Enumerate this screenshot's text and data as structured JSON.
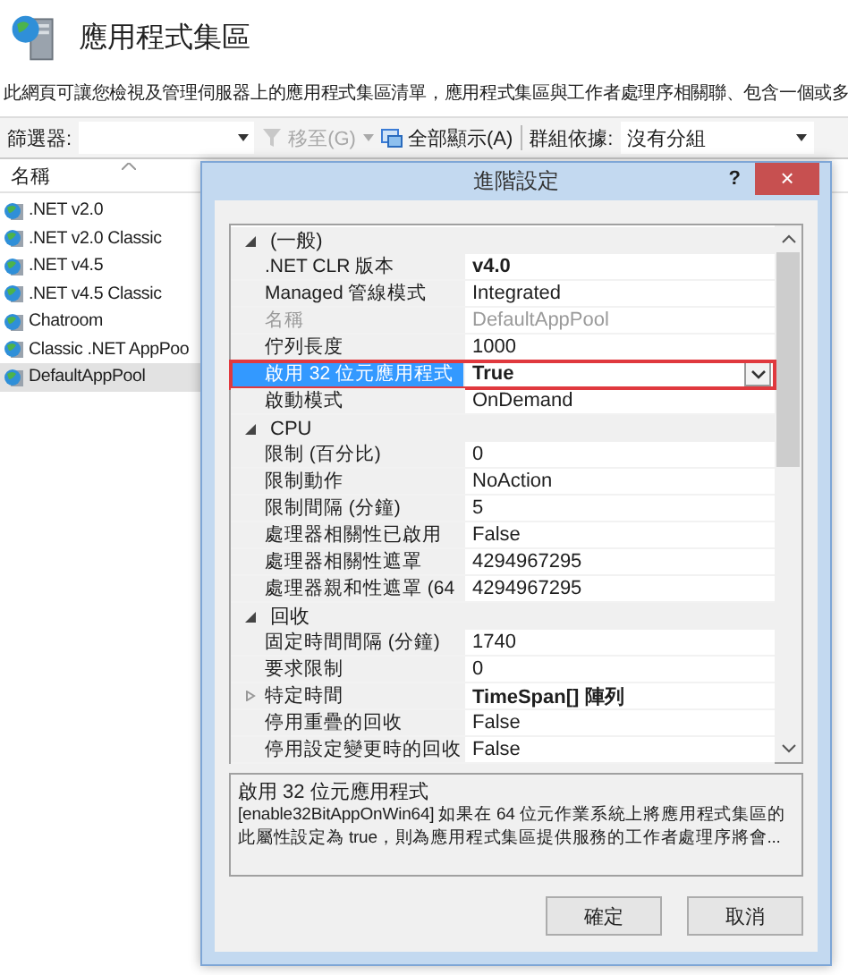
{
  "page": {
    "title": "應用程式集區",
    "description": "此網頁可讓您檢視及管理伺服器上的應用程式集區清單，應用程式集區與工作者處理序相關聯、包含一個或多"
  },
  "toolbar": {
    "filter_label": "篩選器:",
    "go_button": "移至(G)",
    "go_disabled": true,
    "show_all_button": "全部顯示(A)",
    "group_label": "群組依據:",
    "group_value": "沒有分組"
  },
  "list": {
    "header": "名稱",
    "items": [
      {
        "name": ".NET v2.0",
        "selected": false
      },
      {
        "name": ".NET v2.0 Classic",
        "selected": false
      },
      {
        "name": ".NET v4.5",
        "selected": false
      },
      {
        "name": ".NET v4.5 Classic",
        "selected": false
      },
      {
        "name": "Chatroom",
        "selected": false
      },
      {
        "name": "Classic .NET AppPoo",
        "selected": false
      },
      {
        "name": "DefaultAppPool",
        "selected": true
      }
    ]
  },
  "dialog": {
    "title": "進階設定",
    "help": "?",
    "close": "×",
    "rows": [
      {
        "kind": "category",
        "label": "(一般)",
        "expanded": true
      },
      {
        "kind": "property",
        "label": ".NET CLR 版本",
        "value": "v4.0",
        "modified": true,
        "disabled": false,
        "selected": false
      },
      {
        "kind": "property",
        "label": "Managed 管線模式",
        "value": "Integrated",
        "modified": false,
        "disabled": false,
        "selected": false
      },
      {
        "kind": "property",
        "label": "名稱",
        "value": "DefaultAppPool",
        "modified": false,
        "disabled": true,
        "selected": false
      },
      {
        "kind": "property",
        "label": "佇列長度",
        "value": "1000",
        "modified": false,
        "disabled": false,
        "selected": false
      },
      {
        "kind": "property",
        "label": "啟用 32 位元應用程式",
        "value": "True",
        "modified": true,
        "disabled": false,
        "selected": true
      },
      {
        "kind": "property",
        "label": "啟動模式",
        "value": "OnDemand",
        "modified": false,
        "disabled": false,
        "selected": false
      },
      {
        "kind": "category",
        "label": "CPU",
        "expanded": true
      },
      {
        "kind": "property",
        "label": "限制 (百分比)",
        "value": "0",
        "modified": false,
        "disabled": false,
        "selected": false
      },
      {
        "kind": "property",
        "label": "限制動作",
        "value": "NoAction",
        "modified": false,
        "disabled": false,
        "selected": false
      },
      {
        "kind": "property",
        "label": "限制間隔 (分鐘)",
        "value": "5",
        "modified": false,
        "disabled": false,
        "selected": false
      },
      {
        "kind": "property",
        "label": "處理器相關性已啟用",
        "value": "False",
        "modified": false,
        "disabled": false,
        "selected": false
      },
      {
        "kind": "property",
        "label": "處理器相關性遮罩",
        "value": "4294967295",
        "modified": false,
        "disabled": false,
        "selected": false
      },
      {
        "kind": "property",
        "label": "處理器親和性遮罩 (64",
        "value": "4294967295",
        "modified": false,
        "disabled": false,
        "selected": false
      },
      {
        "kind": "category",
        "label": "回收",
        "expanded": true
      },
      {
        "kind": "property",
        "label": "固定時間間隔 (分鐘)",
        "value": "1740",
        "modified": false,
        "disabled": false,
        "selected": false
      },
      {
        "kind": "property",
        "label": "要求限制",
        "value": "0",
        "modified": false,
        "disabled": false,
        "selected": false
      },
      {
        "kind": "property",
        "label": "特定時間",
        "value": "TimeSpan[] 陣列",
        "modified": true,
        "disabled": false,
        "selected": false,
        "expanded": false
      },
      {
        "kind": "property",
        "label": "停用重疊的回收",
        "value": "False",
        "modified": false,
        "disabled": false,
        "selected": false
      },
      {
        "kind": "property",
        "label": "停用設定變更時的回收",
        "value": "False",
        "modified": false,
        "disabled": false,
        "selected": false
      }
    ],
    "description": {
      "title": "啟用 32 位元應用程式",
      "text": "[enable32BitAppOnWin64] 如果在 64 位元作業系統上將應用程式集區的此屬性設定為 true，則為應用程式集區提供服務的工作者處理序將會..."
    },
    "buttons": [
      {
        "label": "確定"
      },
      {
        "label": "取消"
      }
    ]
  }
}
